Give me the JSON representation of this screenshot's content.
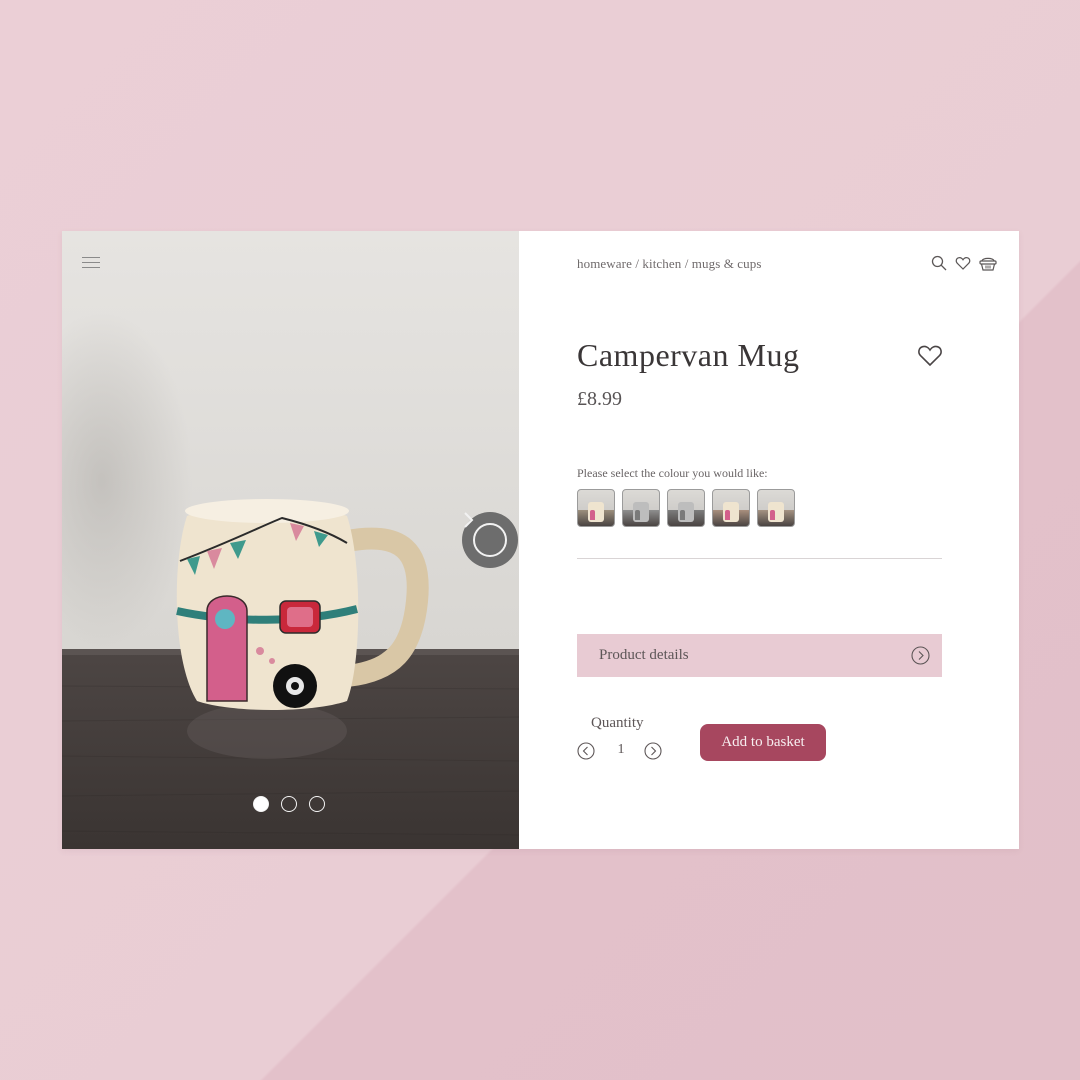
{
  "breadcrumb": {
    "items": [
      "homeware",
      "kitchen",
      "mugs & cups"
    ],
    "separator": "/"
  },
  "header_icons": [
    "search-icon",
    "heart-icon",
    "basket-icon"
  ],
  "product": {
    "name": "Campervan Mug",
    "price": "£8.99",
    "colour_prompt": "Please select the colour you would like:",
    "colour_swatches": [
      {
        "name": "colour-swatch-1",
        "tone": "#9b8e7c"
      },
      {
        "name": "colour-swatch-2",
        "tone": "#8e8e8e"
      },
      {
        "name": "colour-swatch-3",
        "tone": "#7c7c7c"
      },
      {
        "name": "colour-swatch-4",
        "tone": "#a88f7d"
      },
      {
        "name": "colour-swatch-5",
        "tone": "#a49282"
      }
    ]
  },
  "details": {
    "label": "Product details"
  },
  "quantity": {
    "label": "Quantity",
    "value": "1"
  },
  "actions": {
    "add_to_basket": "Add to basket"
  },
  "gallery": {
    "slide_count": 3,
    "active_slide": 1
  },
  "colors": {
    "background": "#ebcfd6",
    "details_bar": "#e8cbd3",
    "button": "#a7475f",
    "text_dark": "#3a3637"
  }
}
